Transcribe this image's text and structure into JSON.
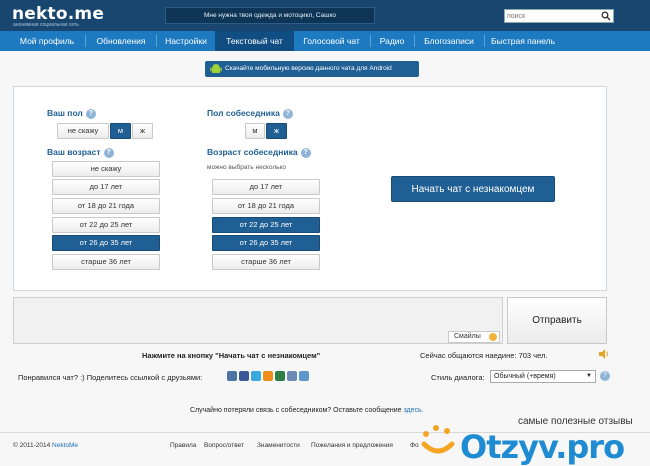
{
  "header": {
    "logo": "nekto.me",
    "logo_sub": "анонимная социальная сеть",
    "motd": "Мне нужна твоя одежда и мотоцикл, Сашко",
    "search_placeholder": "поиск"
  },
  "nav": [
    {
      "label": "Мой профиль"
    },
    {
      "label": "Обновления"
    },
    {
      "label": "Настройки"
    },
    {
      "label": "Текстовый чат",
      "active": true
    },
    {
      "label": "Голосовой чат"
    },
    {
      "label": "Радио"
    },
    {
      "label": "Блогозаписи"
    },
    {
      "label": "Быстрая панель"
    }
  ],
  "android_banner": "Скачайте мобильную версию данного чата для Android",
  "form": {
    "your_gender_label": "Ваш пол",
    "your_gender_options": [
      "не скажу",
      "м",
      "ж"
    ],
    "your_gender_selected": "м",
    "partner_gender_label": "Пол собеседника",
    "partner_gender_options": [
      "м",
      "ж"
    ],
    "partner_gender_selected": "ж",
    "your_age_label": "Ваш возраст",
    "your_age_options": [
      "не скажу",
      "до 17 лет",
      "от 18 до 21 года",
      "от 22 до 25 лет",
      "от 26 до 35 лет",
      "старше 36 лет"
    ],
    "your_age_selected": "от 26 до 35 лет",
    "partner_age_label": "Возраст собеседника",
    "partner_age_hint": "можно выбрать несколько",
    "partner_age_options": [
      "до 17 лет",
      "от 18 до 21 года",
      "от 22 до 25 лет",
      "от 26 до 35 лет",
      "старше 36 лет"
    ],
    "partner_age_selected": [
      "от 22 до 25 лет",
      "от 26 до 35 лет"
    ],
    "start_button": "Начать чат с незнакомцем",
    "help_glyph": "?"
  },
  "chat": {
    "smiles_label": "Смайлы",
    "send_label": "Отправить",
    "instruction": "Нажмите на кнопку \"Начать чат с незнакомцем\"",
    "online": "Сейчас общаются наедине: 703 чел."
  },
  "share": {
    "label": "Понравился чат? :) Поделитесь ссылкой с друзьями:",
    "style_label": "Стиль диалога:",
    "style_value": "Обычный (+время)",
    "lost_text": "Случайно потеряли связь с собеседником? Оставьте сообщение",
    "lost_link": "здесь."
  },
  "footer": {
    "copyright": "© 2011-2014",
    "brand": "NektoMe",
    "links": [
      "Правила",
      "Вопрос/ответ",
      "Знаменитости",
      "Пожелания и предложения",
      "Фо"
    ]
  },
  "watermark": {
    "caption": "самые полезные отзывы",
    "logo": "Otzyv.pro"
  },
  "colors": {
    "header_bg": "#18466e",
    "nav_bg": "#1d7ac0",
    "accent": "#1f5f94"
  }
}
